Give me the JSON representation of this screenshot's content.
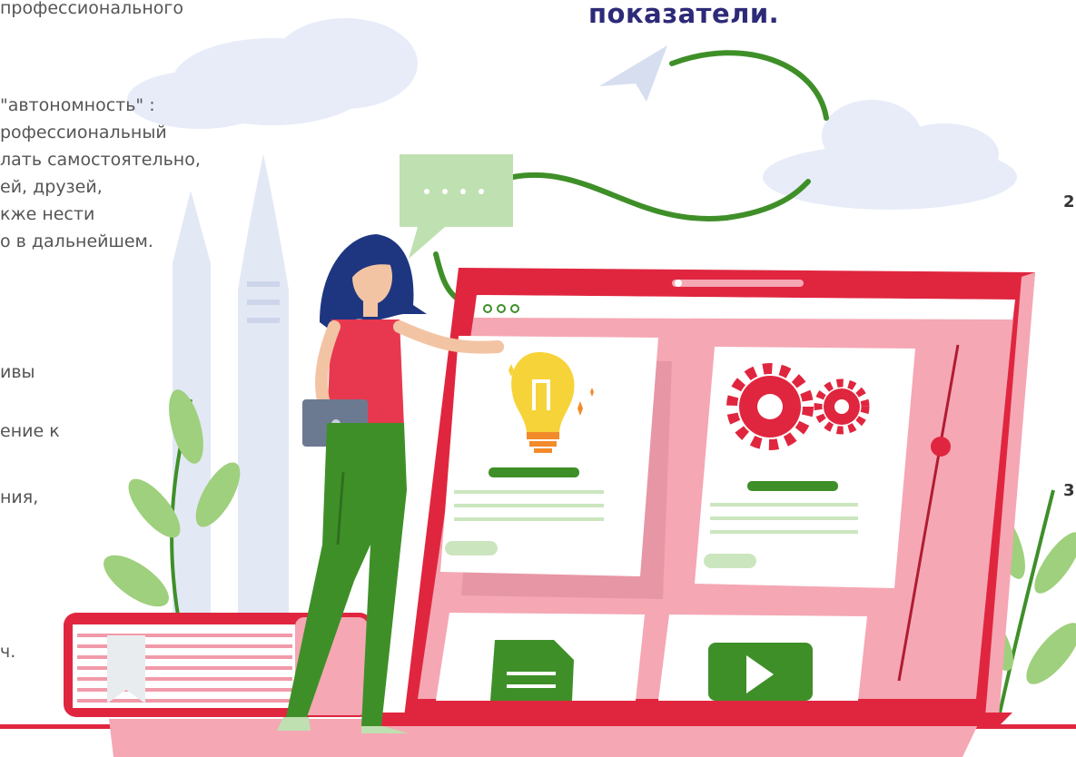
{
  "heading": "показатели.",
  "left_text": {
    "line1": "профессионального",
    "block": [
      "\"автономность\" :",
      "рофессиональный",
      "лать самостоятельно,",
      "ей, друзей,",
      "кже нести",
      "о в дальнейшем."
    ],
    "lower": [
      "ивы",
      "ение к",
      "ния,",
      "ч."
    ]
  },
  "edge_numbers": [
    "2",
    "3"
  ],
  "colors": {
    "accent_red": "#e0263f",
    "pink": "#f5a7b4",
    "green": "#4e9a2e",
    "heading": "#2d2a78",
    "cloud": "#e7ecf8"
  },
  "icons": [
    "lightbulb-icon",
    "gears-icon",
    "document-icon",
    "play-icon",
    "speech-bubble-icon",
    "bookmark-icon"
  ]
}
